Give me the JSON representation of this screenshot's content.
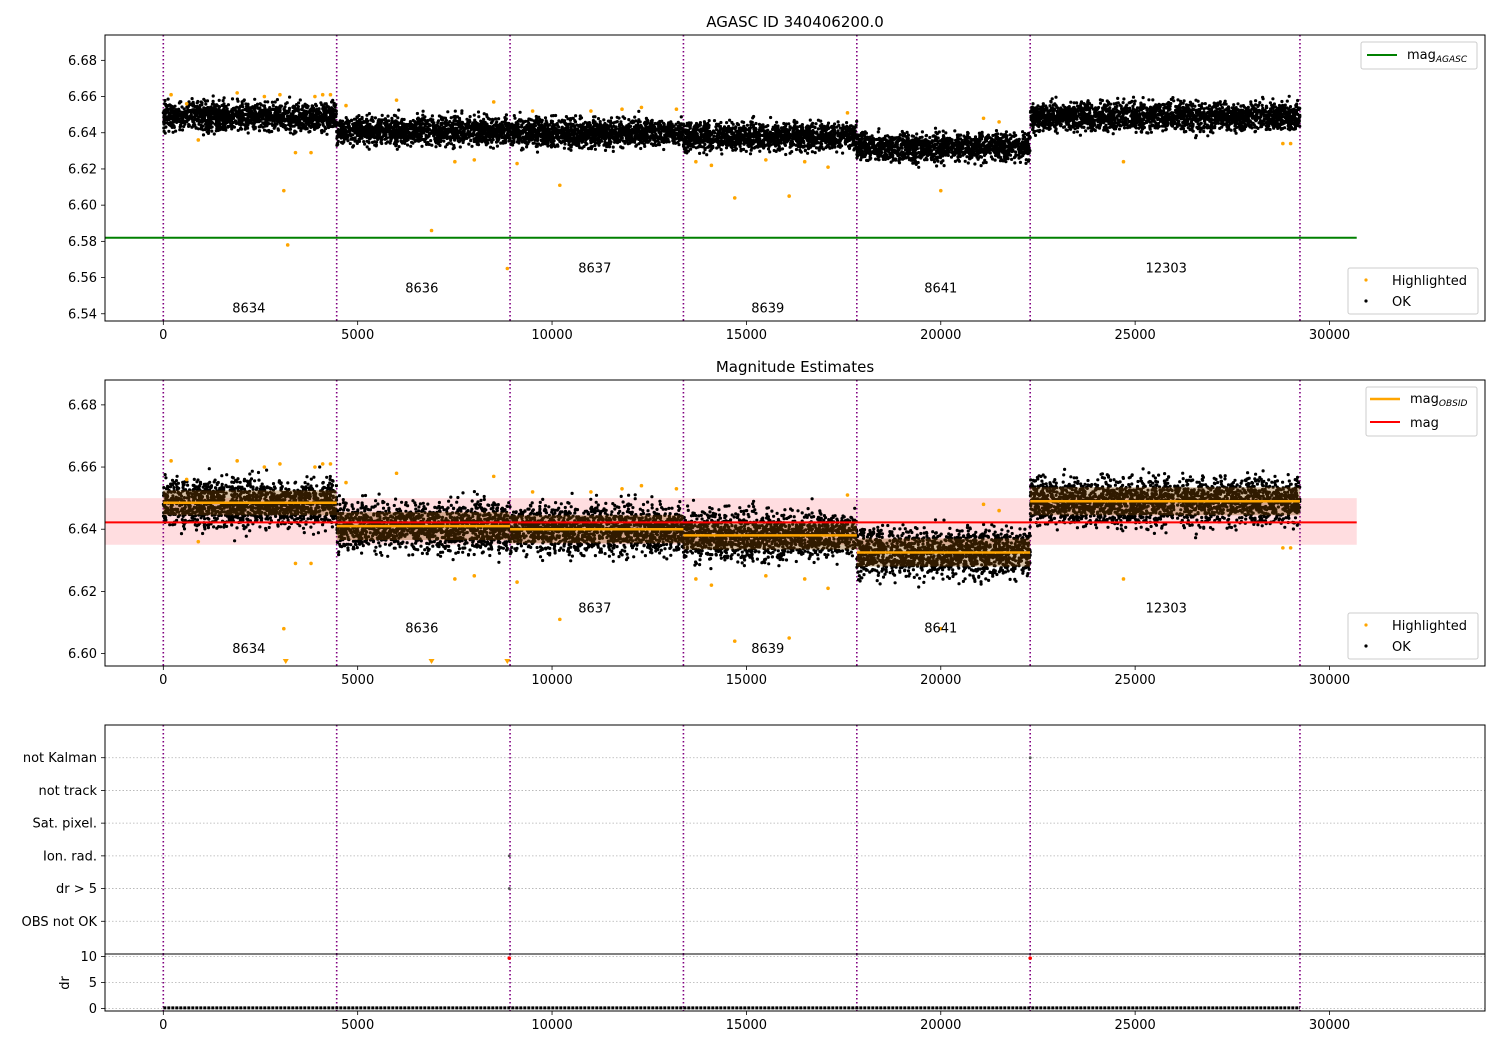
{
  "chart_data": [
    {
      "type": "scatter",
      "title": "AGASC ID 340406200.0",
      "xlim": [
        -1500,
        34000
      ],
      "ylim": [
        6.536,
        6.694
      ],
      "x_ticks": [
        "0",
        "5000",
        "10000",
        "15000",
        "20000",
        "25000",
        "30000"
      ],
      "y_ticks": [
        "6.54",
        "6.56",
        "6.58",
        "6.60",
        "6.62",
        "6.64",
        "6.66",
        "6.68"
      ],
      "obsid_boundaries": [
        0,
        4460,
        8920,
        13380,
        17840,
        22300,
        29240
      ],
      "obsids": [
        {
          "label": "8634",
          "x": 2200,
          "y": 6.543,
          "start": 0,
          "end": 4460,
          "mean": 6.649,
          "spread": 0.007
        },
        {
          "label": "8636",
          "x": 6650,
          "y": 6.554,
          "start": 4460,
          "end": 8920,
          "mean": 6.641,
          "spread": 0.007
        },
        {
          "label": "8637",
          "x": 11100,
          "y": 6.565,
          "start": 8920,
          "end": 13380,
          "mean": 6.64,
          "spread": 0.007
        },
        {
          "label": "8639",
          "x": 15550,
          "y": 6.543,
          "start": 13380,
          "end": 17840,
          "mean": 6.638,
          "spread": 0.007
        },
        {
          "label": "8641",
          "x": 20000,
          "y": 6.554,
          "start": 17840,
          "end": 22300,
          "mean": 6.632,
          "spread": 0.007
        },
        {
          "label": "12303",
          "x": 25800,
          "y": 6.565,
          "start": 22300,
          "end": 29240,
          "mean": 6.649,
          "spread": 0.007
        }
      ],
      "mag_agasc": 6.582,
      "highlighted_points": [
        [
          200,
          6.661
        ],
        [
          600,
          6.656
        ],
        [
          900,
          6.636
        ],
        [
          1900,
          6.662
        ],
        [
          2600,
          6.66
        ],
        [
          3000,
          6.661
        ],
        [
          3100,
          6.608
        ],
        [
          3200,
          6.578
        ],
        [
          3400,
          6.629
        ],
        [
          3800,
          6.629
        ],
        [
          3900,
          6.66
        ],
        [
          4100,
          6.661
        ],
        [
          4300,
          6.661
        ],
        [
          4700,
          6.655
        ],
        [
          6000,
          6.658
        ],
        [
          6900,
          6.586
        ],
        [
          7500,
          6.624
        ],
        [
          8000,
          6.625
        ],
        [
          8500,
          6.657
        ],
        [
          8850,
          6.565
        ],
        [
          9100,
          6.623
        ],
        [
          9500,
          6.652
        ],
        [
          10200,
          6.611
        ],
        [
          11000,
          6.652
        ],
        [
          11800,
          6.653
        ],
        [
          12300,
          6.654
        ],
        [
          13200,
          6.653
        ],
        [
          13700,
          6.624
        ],
        [
          14100,
          6.622
        ],
        [
          14700,
          6.604
        ],
        [
          15500,
          6.625
        ],
        [
          16100,
          6.605
        ],
        [
          16500,
          6.624
        ],
        [
          17100,
          6.621
        ],
        [
          17600,
          6.651
        ],
        [
          20000,
          6.608
        ],
        [
          21100,
          6.648
        ],
        [
          21500,
          6.646
        ],
        [
          24700,
          6.624
        ],
        [
          28800,
          6.634
        ],
        [
          29000,
          6.634
        ]
      ],
      "legend": {
        "position": "right",
        "line_entries": [
          {
            "label": "mag",
            "sub": "AGASC",
            "color": "#008000"
          }
        ],
        "marker_entries": [
          "Highlighted",
          "OK"
        ]
      }
    },
    {
      "type": "scatter",
      "title": "Magnitude Estimates",
      "xlim": [
        -1500,
        34000
      ],
      "ylim": [
        6.596,
        6.688
      ],
      "x_ticks": [
        "0",
        "5000",
        "10000",
        "15000",
        "20000",
        "25000",
        "30000"
      ],
      "y_ticks": [
        "6.60",
        "6.62",
        "6.64",
        "6.66",
        "6.68"
      ],
      "obsids": [
        {
          "label": "8634",
          "x": 2200,
          "y": 6.6015
        },
        {
          "label": "8636",
          "x": 6650,
          "y": 6.608
        },
        {
          "label": "8637",
          "x": 11100,
          "y": 6.6145
        },
        {
          "label": "8639",
          "x": 15550,
          "y": 6.6015
        },
        {
          "label": "8641",
          "x": 20000,
          "y": 6.608
        },
        {
          "label": "12303",
          "x": 25800,
          "y": 6.6145
        }
      ],
      "mag_obsid": [
        {
          "start": 0,
          "end": 4460,
          "value": 6.6485,
          "band": [
            6.6445,
            6.6525
          ]
        },
        {
          "start": 4460,
          "end": 8920,
          "value": 6.641,
          "band": [
            6.6365,
            6.6455
          ]
        },
        {
          "start": 8920,
          "end": 13380,
          "value": 6.64,
          "band": [
            6.6355,
            6.6445
          ]
        },
        {
          "start": 13380,
          "end": 17840,
          "value": 6.638,
          "band": [
            6.6335,
            6.6425
          ]
        },
        {
          "start": 17840,
          "end": 22300,
          "value": 6.6325,
          "band": [
            6.628,
            6.637
          ]
        },
        {
          "start": 22300,
          "end": 29240,
          "value": 6.649,
          "band": [
            6.6445,
            6.6535
          ]
        }
      ],
      "mag_overall": {
        "value": 6.6422,
        "band": [
          6.635,
          6.65
        ],
        "x_end": 30700
      },
      "highlighted_points": [
        [
          200,
          6.662
        ],
        [
          600,
          6.656
        ],
        [
          900,
          6.636
        ],
        [
          1900,
          6.662
        ],
        [
          2600,
          6.66
        ],
        [
          3000,
          6.661
        ],
        [
          3100,
          6.608
        ],
        [
          3400,
          6.629
        ],
        [
          3800,
          6.629
        ],
        [
          3900,
          6.66
        ],
        [
          4100,
          6.661
        ],
        [
          4300,
          6.661
        ],
        [
          4700,
          6.655
        ],
        [
          6000,
          6.658
        ],
        [
          7500,
          6.624
        ],
        [
          8000,
          6.625
        ],
        [
          8500,
          6.657
        ],
        [
          9100,
          6.623
        ],
        [
          9500,
          6.652
        ],
        [
          10200,
          6.611
        ],
        [
          11000,
          6.652
        ],
        [
          11800,
          6.653
        ],
        [
          12300,
          6.654
        ],
        [
          13200,
          6.653
        ],
        [
          13700,
          6.624
        ],
        [
          14100,
          6.622
        ],
        [
          14700,
          6.604
        ],
        [
          15500,
          6.625
        ],
        [
          16100,
          6.605
        ],
        [
          16500,
          6.624
        ],
        [
          17100,
          6.621
        ],
        [
          17600,
          6.651
        ],
        [
          20000,
          6.608
        ],
        [
          21100,
          6.648
        ],
        [
          21500,
          6.646
        ],
        [
          24700,
          6.624
        ],
        [
          28800,
          6.634
        ],
        [
          29000,
          6.634
        ]
      ],
      "clipped_points": [
        3150,
        6900,
        8850
      ],
      "legend": {
        "position": "right",
        "line_entries": [
          {
            "label": "mag",
            "sub": "OBSID",
            "color": "#ffa500"
          },
          {
            "label": "mag",
            "sub": "",
            "color": "#ff0000"
          }
        ],
        "marker_entries": [
          "Highlighted",
          "OK"
        ]
      }
    },
    {
      "type": "scatter",
      "title": "",
      "xlim": [
        -1500,
        34000
      ],
      "categories": [
        "OBS not OK",
        "dr > 5",
        "Ion. rad.",
        "Sat. pixel.",
        "not track",
        "not Kalman"
      ],
      "flag_points": [
        [
          "dr > 5",
          8900
        ],
        [
          "Ion. rad.",
          8900
        ],
        [
          "not Kalman",
          22300
        ]
      ]
    },
    {
      "type": "scatter",
      "title": "",
      "xlim": [
        -1500,
        34000
      ],
      "ylabel": "dr",
      "y_ticks": [
        "0",
        "5",
        "10"
      ],
      "ylim": [
        -0.5,
        10.5
      ],
      "baseline": 0.1,
      "outliers": [
        [
          8900,
          9.7
        ],
        [
          22300,
          9.7
        ]
      ]
    }
  ]
}
